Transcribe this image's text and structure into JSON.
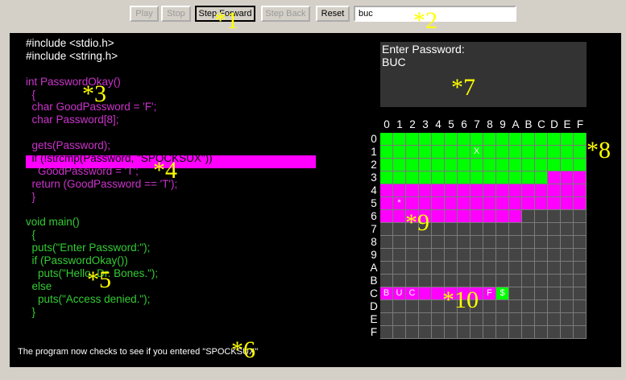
{
  "toolbar": {
    "play_label": "Play",
    "stop_label": "Stop",
    "step_forward_label": "Step Forward",
    "step_back_label": "Step Back",
    "reset_label": "Reset",
    "input_value": "buc"
  },
  "code_lines": [
    {
      "text": "#include <stdio.h>",
      "color": "#ffffff"
    },
    {
      "text": "#include <string.h>",
      "color": "#ffffff"
    },
    {
      "text": "",
      "color": "#cc33cc"
    },
    {
      "text": "int PasswordOkay()",
      "color": "#cc33cc"
    },
    {
      "text": "  {",
      "color": "#cc33cc"
    },
    {
      "text": "  char GoodPassword = 'F';",
      "color": "#cc33cc"
    },
    {
      "text": "  char Password[8];",
      "color": "#cc33cc"
    },
    {
      "text": "",
      "color": "#cc33cc"
    },
    {
      "text": "  gets(Password);",
      "color": "#cc33cc"
    },
    {
      "text": "  if (!strcmp(Password, \"SPOCKSUX\"))",
      "color": "#000000"
    },
    {
      "text": "    GoodPassword = 'T';",
      "color": "#cc33cc"
    },
    {
      "text": "  return (GoodPassword == 'T');",
      "color": "#cc33cc"
    },
    {
      "text": "  }",
      "color": "#cc33cc"
    },
    {
      "text": "",
      "color": "#33cc33"
    },
    {
      "text": "void main()",
      "color": "#33cc33"
    },
    {
      "text": "  {",
      "color": "#33cc33"
    },
    {
      "text": "  puts(\"Enter Password:\");",
      "color": "#33cc33"
    },
    {
      "text": "  if (PasswordOkay())",
      "color": "#33cc33"
    },
    {
      "text": "    puts(\"Hello, Dr. Bones.\");",
      "color": "#33cc33"
    },
    {
      "text": "  else",
      "color": "#33cc33"
    },
    {
      "text": "    puts(\"Access denied.\");",
      "color": "#33cc33"
    },
    {
      "text": "  }",
      "color": "#33cc33"
    }
  ],
  "status_text": "The program now checks to see if you entered \"SPOCKSUX\"",
  "console": {
    "line1": "Enter Password:",
    "line2": "BUC"
  },
  "memory": {
    "hex_digits": [
      "0",
      "1",
      "2",
      "3",
      "4",
      "5",
      "6",
      "7",
      "8",
      "9",
      "A",
      "B",
      "C",
      "D",
      "E",
      "F"
    ],
    "colors": {
      "green": "#00ff00",
      "magenta": "#ff00ff",
      "empty": "#444444"
    },
    "row_fill": [
      {
        "row": 0,
        "from": 0,
        "to": 15,
        "color": "green"
      },
      {
        "row": 1,
        "from": 0,
        "to": 15,
        "color": "green"
      },
      {
        "row": 2,
        "from": 0,
        "to": 15,
        "color": "green"
      },
      {
        "row": 3,
        "from": 0,
        "to": 12,
        "color": "green"
      },
      {
        "row": 3,
        "from": 13,
        "to": 15,
        "color": "magenta"
      },
      {
        "row": 4,
        "from": 0,
        "to": 15,
        "color": "magenta"
      },
      {
        "row": 5,
        "from": 0,
        "to": 15,
        "color": "magenta"
      },
      {
        "row": 6,
        "from": 0,
        "to": 10,
        "color": "magenta"
      },
      {
        "row": 12,
        "from": 0,
        "to": 8,
        "color": "magenta"
      },
      {
        "row": 12,
        "from": 9,
        "to": 9,
        "color": "green"
      }
    ],
    "cell_text": [
      {
        "row": 1,
        "col": 7,
        "text": "X"
      },
      {
        "row": 5,
        "col": 1,
        "text": "*"
      },
      {
        "row": 12,
        "col": 0,
        "text": "B"
      },
      {
        "row": 12,
        "col": 1,
        "text": "U"
      },
      {
        "row": 12,
        "col": 2,
        "text": "C"
      },
      {
        "row": 12,
        "col": 8,
        "text": "F"
      },
      {
        "row": 12,
        "col": 9,
        "text": "$"
      }
    ]
  },
  "annotations": [
    "*1",
    "*2",
    "*3",
    "*4",
    "*5",
    "*6",
    "*7",
    "*8",
    "*9",
    "*10"
  ]
}
